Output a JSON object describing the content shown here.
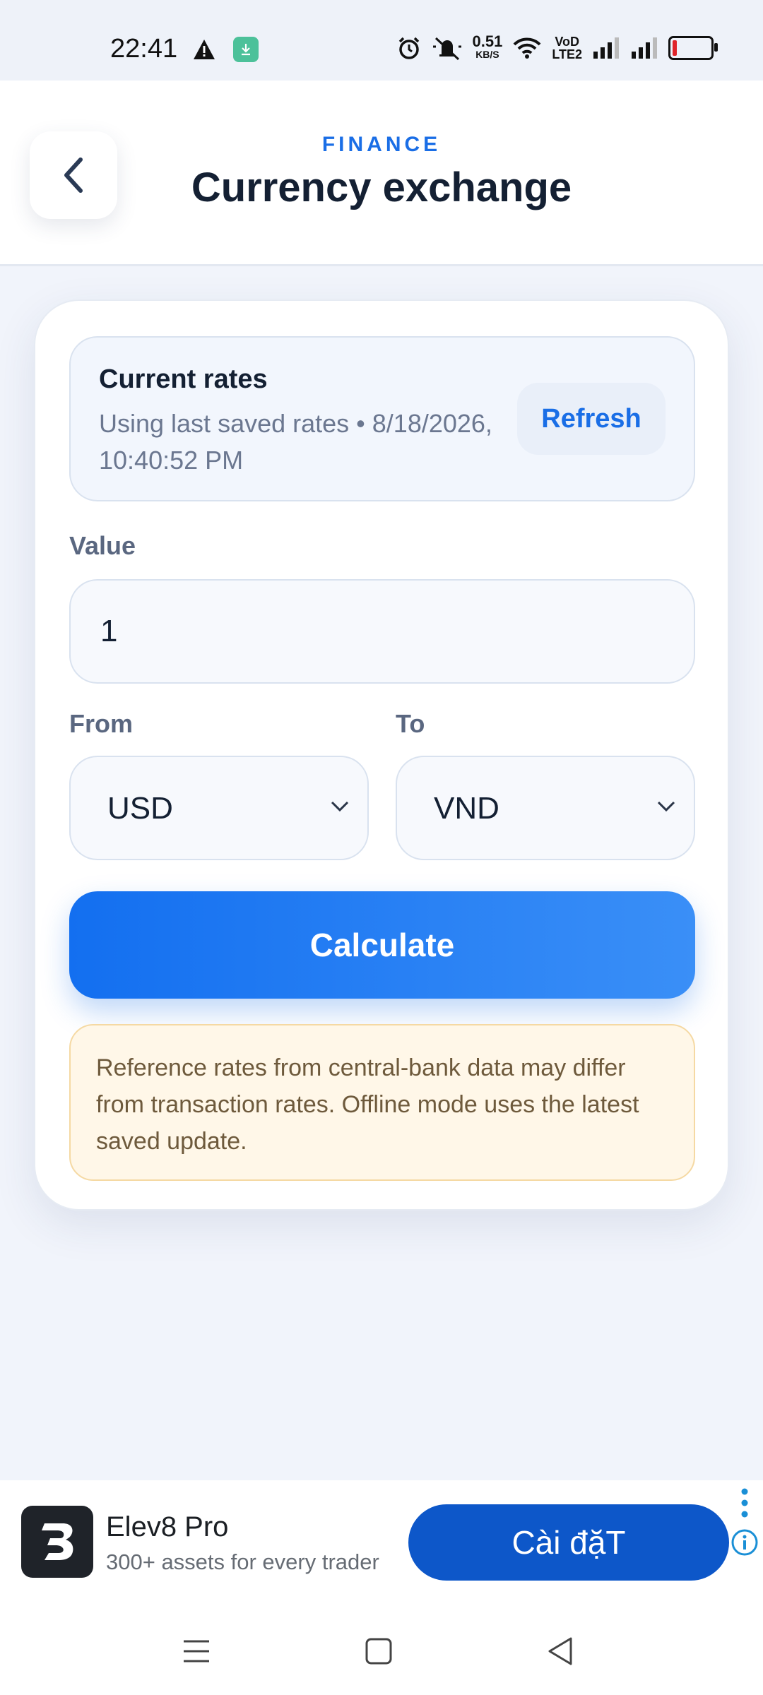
{
  "status_bar": {
    "time": "22:41",
    "net_speed_value": "0.51",
    "net_speed_unit": "KB/S",
    "volte_line1": "VoD",
    "volte_line2": "LTE2"
  },
  "header": {
    "eyebrow": "FINANCE",
    "title": "Currency exchange"
  },
  "rates": {
    "title": "Current rates",
    "subtitle": "Using last saved rates • 8/18/2026, 10:40:52 PM",
    "refresh_label": "Refresh"
  },
  "form": {
    "value_label": "Value",
    "value": "1",
    "from_label": "From",
    "from_value": "USD",
    "to_label": "To",
    "to_value": "VND",
    "calculate_label": "Calculate"
  },
  "notice": {
    "text": "Reference rates from central-bank data may differ from transaction rates. Offline mode uses the latest saved update."
  },
  "ad": {
    "title": "Elev8 Pro",
    "subtitle": "300+ assets for every trader",
    "cta": "Cài đặT"
  },
  "colors": {
    "accent": "#1a6ee6",
    "background": "#f1f4fb",
    "ad_cta": "#0d57c9",
    "notice_bg": "#fff7e8"
  }
}
